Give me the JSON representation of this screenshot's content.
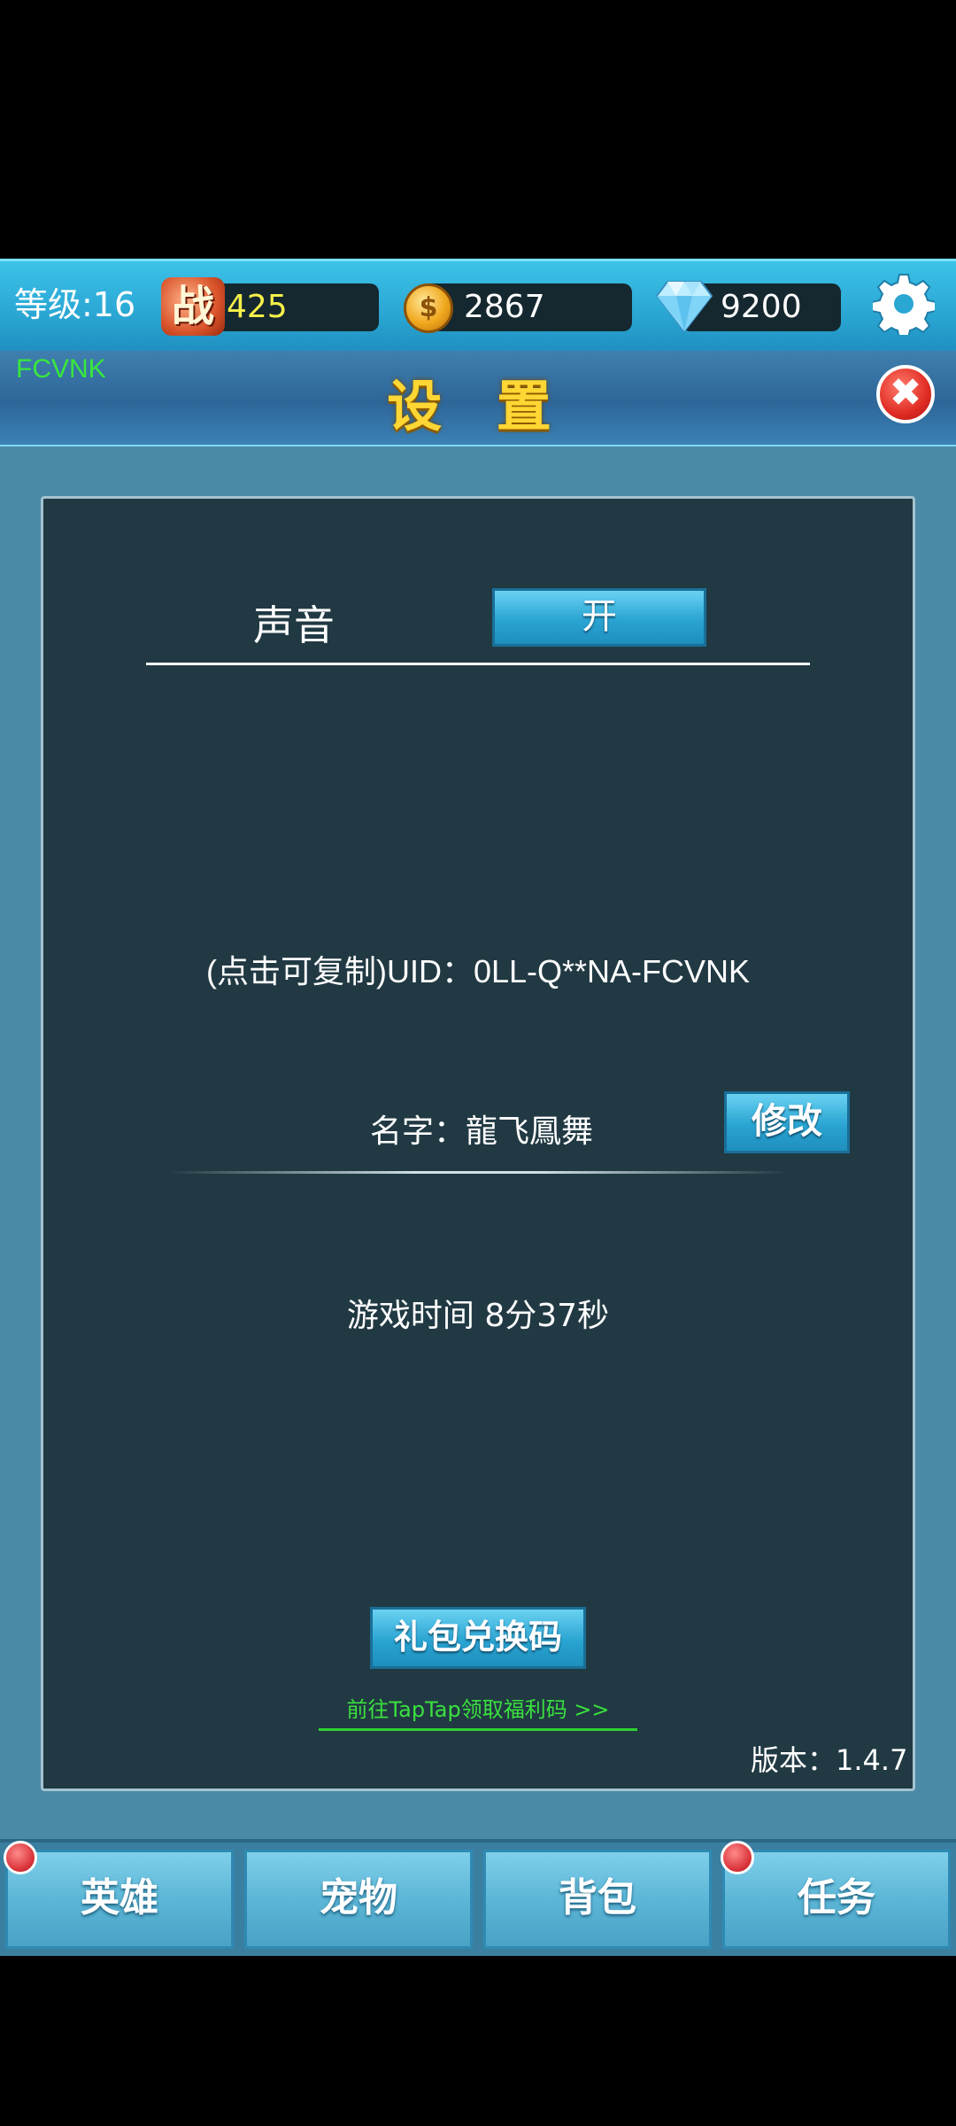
{
  "top_bar": {
    "level_label": "等级:16",
    "power_icon_glyph": "战",
    "power_value": "425",
    "gold_icon_glyph": "$",
    "gold_value": "2867",
    "gem_value": "9200",
    "icons": [
      "power-icon",
      "gold-coin-icon",
      "diamond-icon",
      "gear-icon"
    ]
  },
  "panel": {
    "player_code": "FCVNK",
    "title": "设 置",
    "close_glyph": "✖"
  },
  "settings": {
    "sound_label": "声音",
    "sound_toggle_label": "开",
    "uid_text": "(点击可复制)UID：0LL-Q**NA-FCVNK",
    "name_text": "名字：龍飞鳳舞",
    "rename_label": "修改",
    "playtime_text": "游戏时间 8分37秒",
    "gift_code_label": "礼包兑换码",
    "taptap_link_text": "前往TapTap领取福利码 >>",
    "version_text": "版本：1.4.7"
  },
  "bottom_nav": {
    "tabs": [
      {
        "label": "英雄",
        "badge": true
      },
      {
        "label": "宠物",
        "badge": false
      },
      {
        "label": "背包",
        "badge": false
      },
      {
        "label": "任务",
        "badge": true
      }
    ]
  },
  "colors": {
    "accent": "#2aa6d3",
    "title_gold": "#ffd633",
    "link_green": "#3ae03e",
    "panel_dark": "#213943"
  }
}
